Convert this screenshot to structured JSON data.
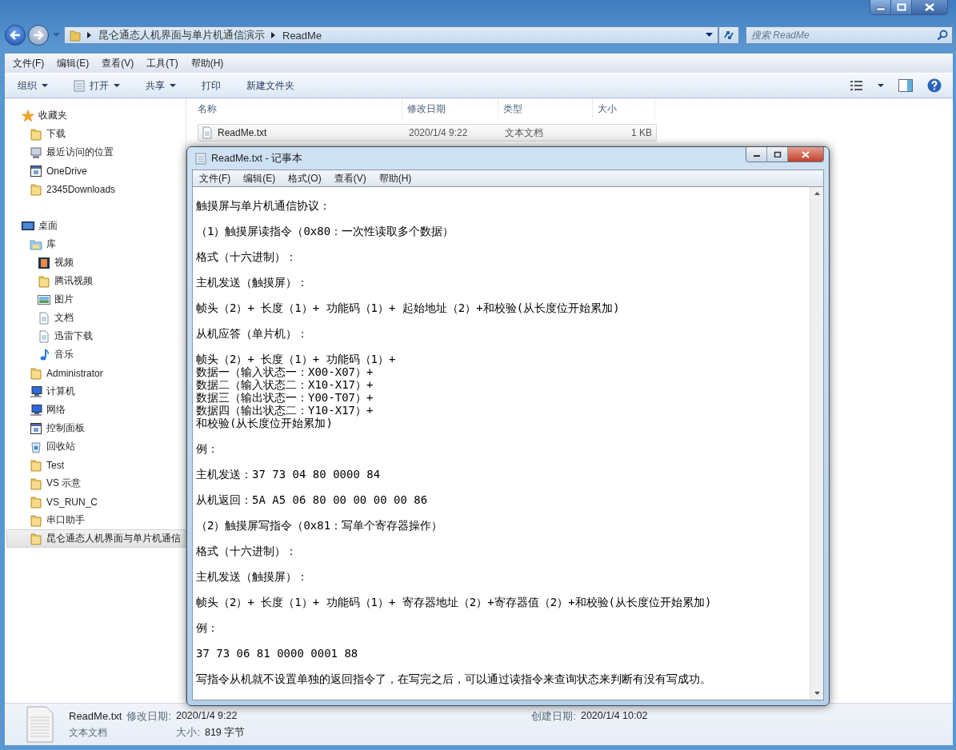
{
  "explorer": {
    "breadcrumb": [
      "昆仑通态人机界面与单片机通信演示",
      "ReadMe"
    ],
    "search": {
      "placeholder": "搜索 ReadMe"
    },
    "menu": [
      "文件(F)",
      "编辑(E)",
      "查看(V)",
      "工具(T)",
      "帮助(H)"
    ],
    "toolbar": [
      {
        "label": "组织",
        "kind": "menu"
      },
      {
        "label": "打开",
        "kind": "open"
      },
      {
        "label": "共享",
        "kind": "menu"
      },
      {
        "label": "打印",
        "kind": "plain"
      },
      {
        "label": "新建文件夹",
        "kind": "plain"
      }
    ],
    "sidebar": [
      {
        "label": "收藏夹",
        "kind": "star",
        "selected": false,
        "children": [
          {
            "label": "下载",
            "kind": "folder",
            "selected": false
          },
          {
            "label": "最近访问的位置",
            "kind": "recent",
            "selected": false
          },
          {
            "label": "OneDrive",
            "kind": "window",
            "selected": false
          },
          {
            "label": "2345Downloads",
            "kind": "folder",
            "selected": false
          }
        ]
      },
      {
        "label": "桌面",
        "kind": "desktop",
        "selected": false,
        "children": [
          {
            "label": "库",
            "kind": "library",
            "selected": false,
            "children": [
              {
                "label": "视频",
                "kind": "film",
                "selected": false
              },
              {
                "label": "腾讯视频",
                "kind": "folder",
                "selected": false
              },
              {
                "label": "图片",
                "kind": "picture",
                "selected": false
              },
              {
                "label": "文档",
                "kind": "doc",
                "selected": false
              },
              {
                "label": "迅雷下载",
                "kind": "doc",
                "selected": false
              },
              {
                "label": "音乐",
                "kind": "music",
                "selected": false
              }
            ]
          },
          {
            "label": "Administrator",
            "kind": "folder",
            "selected": false
          },
          {
            "label": "计算机",
            "kind": "computer",
            "selected": false
          },
          {
            "label": "网络",
            "kind": "computer",
            "selected": false
          },
          {
            "label": "控制面板",
            "kind": "window",
            "selected": false
          },
          {
            "label": "回收站",
            "kind": "bin",
            "selected": false
          },
          {
            "label": "Test",
            "kind": "folder",
            "selected": false
          },
          {
            "label": "VS 示意",
            "kind": "folder",
            "selected": false
          },
          {
            "label": "VS_RUN_C",
            "kind": "folder",
            "selected": false
          },
          {
            "label": "串口助手",
            "kind": "folder",
            "selected": false
          },
          {
            "label": "昆仑通态人机界面与单片机通信",
            "kind": "folder",
            "selected": true
          }
        ]
      }
    ],
    "columns": [
      "名称",
      "修改日期",
      "类型",
      "大小"
    ],
    "rows": [
      {
        "name": "ReadMe.txt",
        "date": "2020/1/4 9:22",
        "type": "文本文档",
        "size": "1 KB",
        "selected": true
      }
    ],
    "details": {
      "name": "ReadMe.txt",
      "type": "文本文档",
      "fields": [
        {
          "label": "修改日期:",
          "value": "2020/1/4 9:22"
        },
        {
          "label": "创建日期:",
          "value": "2020/1/4 10:02"
        },
        {
          "label": "大小:",
          "value": "819 字节"
        }
      ]
    }
  },
  "notepad": {
    "title": "ReadMe.txt - 记事本",
    "menu": [
      "文件(F)",
      "编辑(E)",
      "格式(O)",
      "查看(V)",
      "帮助(H)"
    ],
    "paragraphs": [
      [
        "触摸屏与单片机通信协议："
      ],
      [
        "（1）触摸屏读指令（0x80：一次性读取多个数据）"
      ],
      [
        "格式（十六进制）："
      ],
      [
        "主机发送（触摸屏）："
      ],
      [
        "帧头（2）+ 长度（1）+ 功能码（1）+ 起始地址（2）+和校验(从长度位开始累加)"
      ],
      [
        "从机应答（单片机）："
      ],
      [
        "帧头（2）+ 长度（1）+ 功能码（1）+",
        "数据一（输入状态一：X00-X07）+",
        "数据二（输入状态二：X10-X17）+",
        "数据三（输出状态一：Y00-T07）+",
        "数据四（输出状态二：Y10-X17）+",
        "和校验(从长度位开始累加)"
      ],
      [
        "例："
      ],
      [
        "主机发送：37 73 04 80 0000 84"
      ],
      [
        "从机返回：5A A5 06 80 00 00 00 00 86"
      ],
      [
        "（2）触摸屏写指令（0x81：写单个寄存器操作）"
      ],
      [
        "格式（十六进制）："
      ],
      [
        "主机发送（触摸屏）："
      ],
      [
        "帧头（2）+ 长度（1）+ 功能码（1）+ 寄存器地址（2）+寄存器值（2）+和校验(从长度位开始累加)"
      ],
      [
        "例："
      ],
      [
        "37 73 06 81 0000 0001 88"
      ],
      [
        "写指令从机就不设置单独的返回指令了，在写完之后，可以通过读指令来查询状态来判断有没有写成功。"
      ]
    ]
  }
}
